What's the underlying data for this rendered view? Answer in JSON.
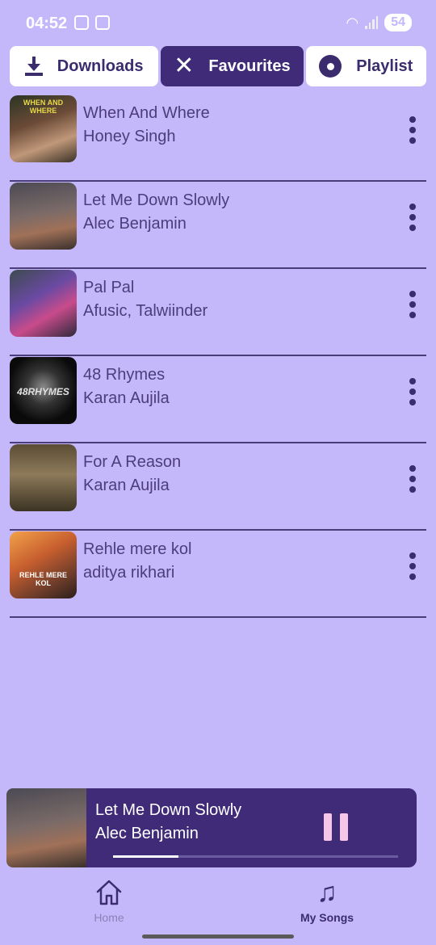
{
  "status_bar": {
    "time": "04:52",
    "battery": "54"
  },
  "tabs": [
    {
      "label": "Downloads",
      "icon": "download-icon"
    },
    {
      "label": "Favourites",
      "icon": "close-icon",
      "active": true
    },
    {
      "label": "Playlist",
      "icon": "disc-icon"
    }
  ],
  "songs": [
    {
      "title": "When And Where",
      "artist": "Honey Singh",
      "art_text": "WHEN AND WHERE"
    },
    {
      "title": "Let Me Down Slowly",
      "artist": "Alec Benjamin"
    },
    {
      "title": "Pal Pal",
      "artist": "Afusic, Talwiinder"
    },
    {
      "title": "48 Rhymes",
      "artist": "Karan Aujila",
      "art_text": "48RHYMES"
    },
    {
      "title": "For A Reason",
      "artist": "Karan Aujila"
    },
    {
      "title": "Rehle mere kol",
      "artist": "aditya rikhari",
      "art_text": "REHLE MERE KOL"
    }
  ],
  "now_playing": {
    "title": "Let Me Down Slowly",
    "artist": "Alec Benjamin",
    "progress": 0.23,
    "state": "playing"
  },
  "bottom_nav": {
    "home_label": "Home",
    "my_songs_label": "My Songs",
    "active": "My Songs"
  },
  "colors": {
    "background": "#c4b8fb",
    "accent": "#3f2b78",
    "pause_icon": "#f6c5e8"
  }
}
